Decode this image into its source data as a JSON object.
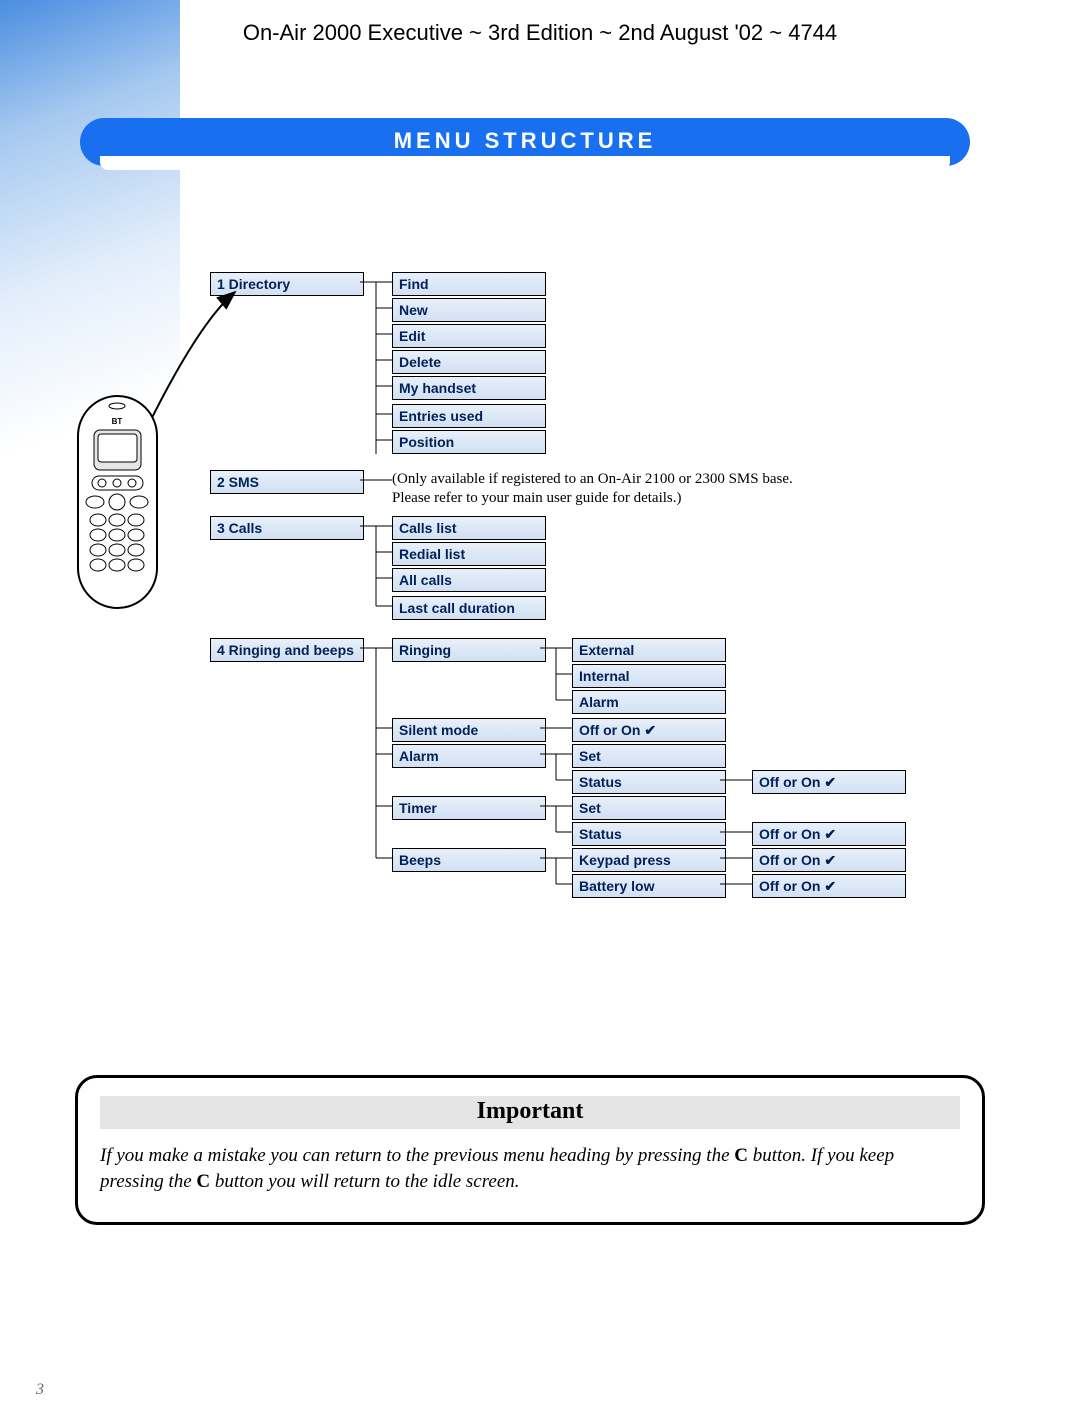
{
  "header": "On-Air 2000 Executive ~ 3rd Edition ~ 2nd August '02 ~ 4744",
  "title": "MENU STRUCTURE",
  "menu": {
    "l1": {
      "directory": "1 Directory",
      "sms": "2 SMS",
      "calls": "3 Calls",
      "ringing": "4 Ringing and beeps"
    },
    "directory": [
      "Find",
      "New",
      "Edit",
      "Delete",
      "My handset",
      "Entries used",
      "Position"
    ],
    "sms_note": "(Only available if registered to an On-Air 2100 or 2300 SMS base.\nPlease refer to your main user guide for details.)",
    "calls": [
      "Calls list",
      "Redial list",
      "All calls",
      "Last call duration"
    ],
    "ringing_l2": [
      "Ringing",
      "Silent mode",
      "Alarm",
      "Timer",
      "Beeps"
    ],
    "ringing_sub": {
      "ringing": [
        "External",
        "Internal",
        "Alarm"
      ],
      "silent": [
        "Off or On ✔"
      ],
      "alarm": [
        "Set",
        "Status"
      ],
      "timer": [
        "Set",
        "Status"
      ],
      "beeps": [
        "Keypad press",
        "Battery low"
      ]
    },
    "offon": "Off or On ✔"
  },
  "important": {
    "heading": "Important",
    "body_1": "If you make a mistake you can return to the previous menu heading by pressing the ",
    "body_c": "C",
    "body_2": " button. If you keep pressing the ",
    "body_3": " button you will return to the idle screen."
  },
  "page": "3"
}
